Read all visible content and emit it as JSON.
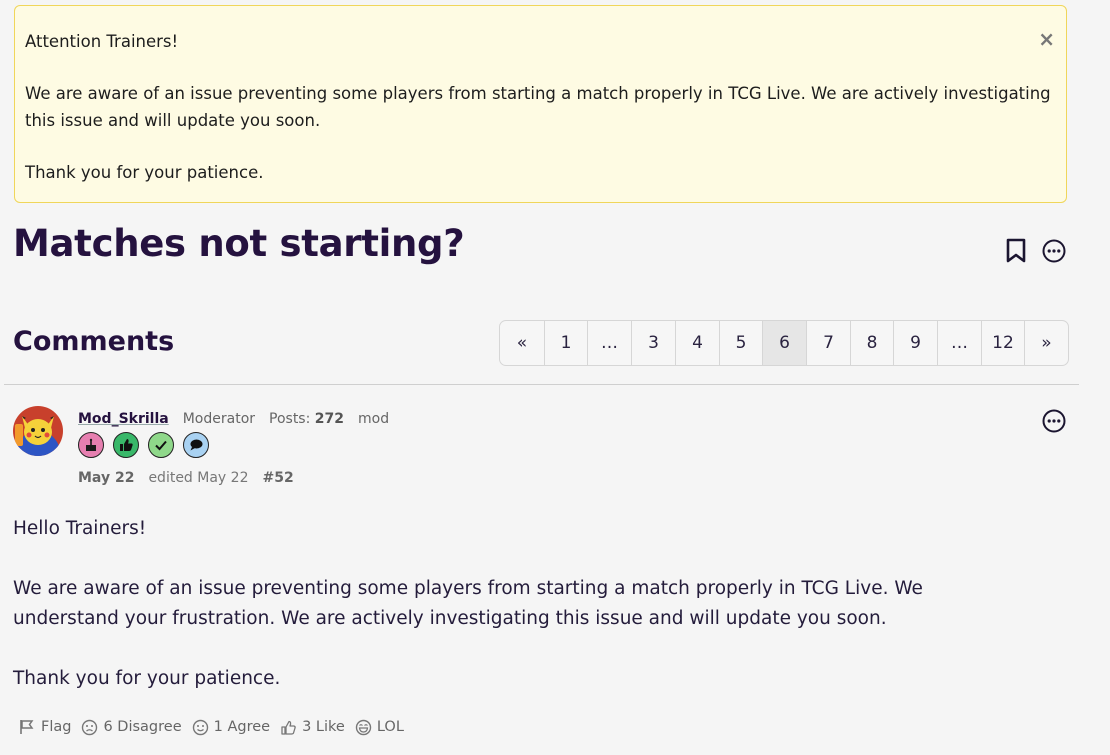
{
  "banner": {
    "heading": "Attention Trainers!",
    "message": "We are aware of an issue preventing some players from starting a match properly in TCG Live. We are actively investigating this issue and will update you soon.",
    "closing": "Thank you for your patience.",
    "close_label": "×"
  },
  "discussion": {
    "title": "Matches not starting?"
  },
  "comments": {
    "heading": "Comments"
  },
  "pager": {
    "pages": [
      "«",
      "1",
      "…",
      "3",
      "4",
      "5",
      "6",
      "7",
      "8",
      "9",
      "…",
      "12",
      "»"
    ],
    "active": "6"
  },
  "post": {
    "author": "Mod_Skrilla",
    "role": "Moderator",
    "posts_label": "Posts:",
    "posts_count": "272",
    "rank": "mod",
    "date": "May 22",
    "edited": "edited May 22",
    "number": "#52",
    "badges": [
      "cake-badge",
      "thumbs-up-badge",
      "check-badge",
      "comment-badge"
    ],
    "greeting": "Hello Trainers!",
    "paragraph": "We are aware of an issue preventing some players from starting a match properly in TCG Live. We understand your frustration. We are actively investigating this issue and will update you soon.",
    "closing": "Thank you for your patience."
  },
  "reactions": {
    "flag": "Flag",
    "disagree": "6 Disagree",
    "agree": "1 Agree",
    "like": "3 Like",
    "lol": "LOL"
  },
  "colors": {
    "banner_bg": "#fefbe3",
    "banner_border": "#f0d65a",
    "title": "#25123f",
    "badge_cake": "#e67fb0",
    "badge_thumbs": "#39b86a",
    "badge_check": "#8fd88a",
    "badge_comment": "#a9d2f2"
  }
}
